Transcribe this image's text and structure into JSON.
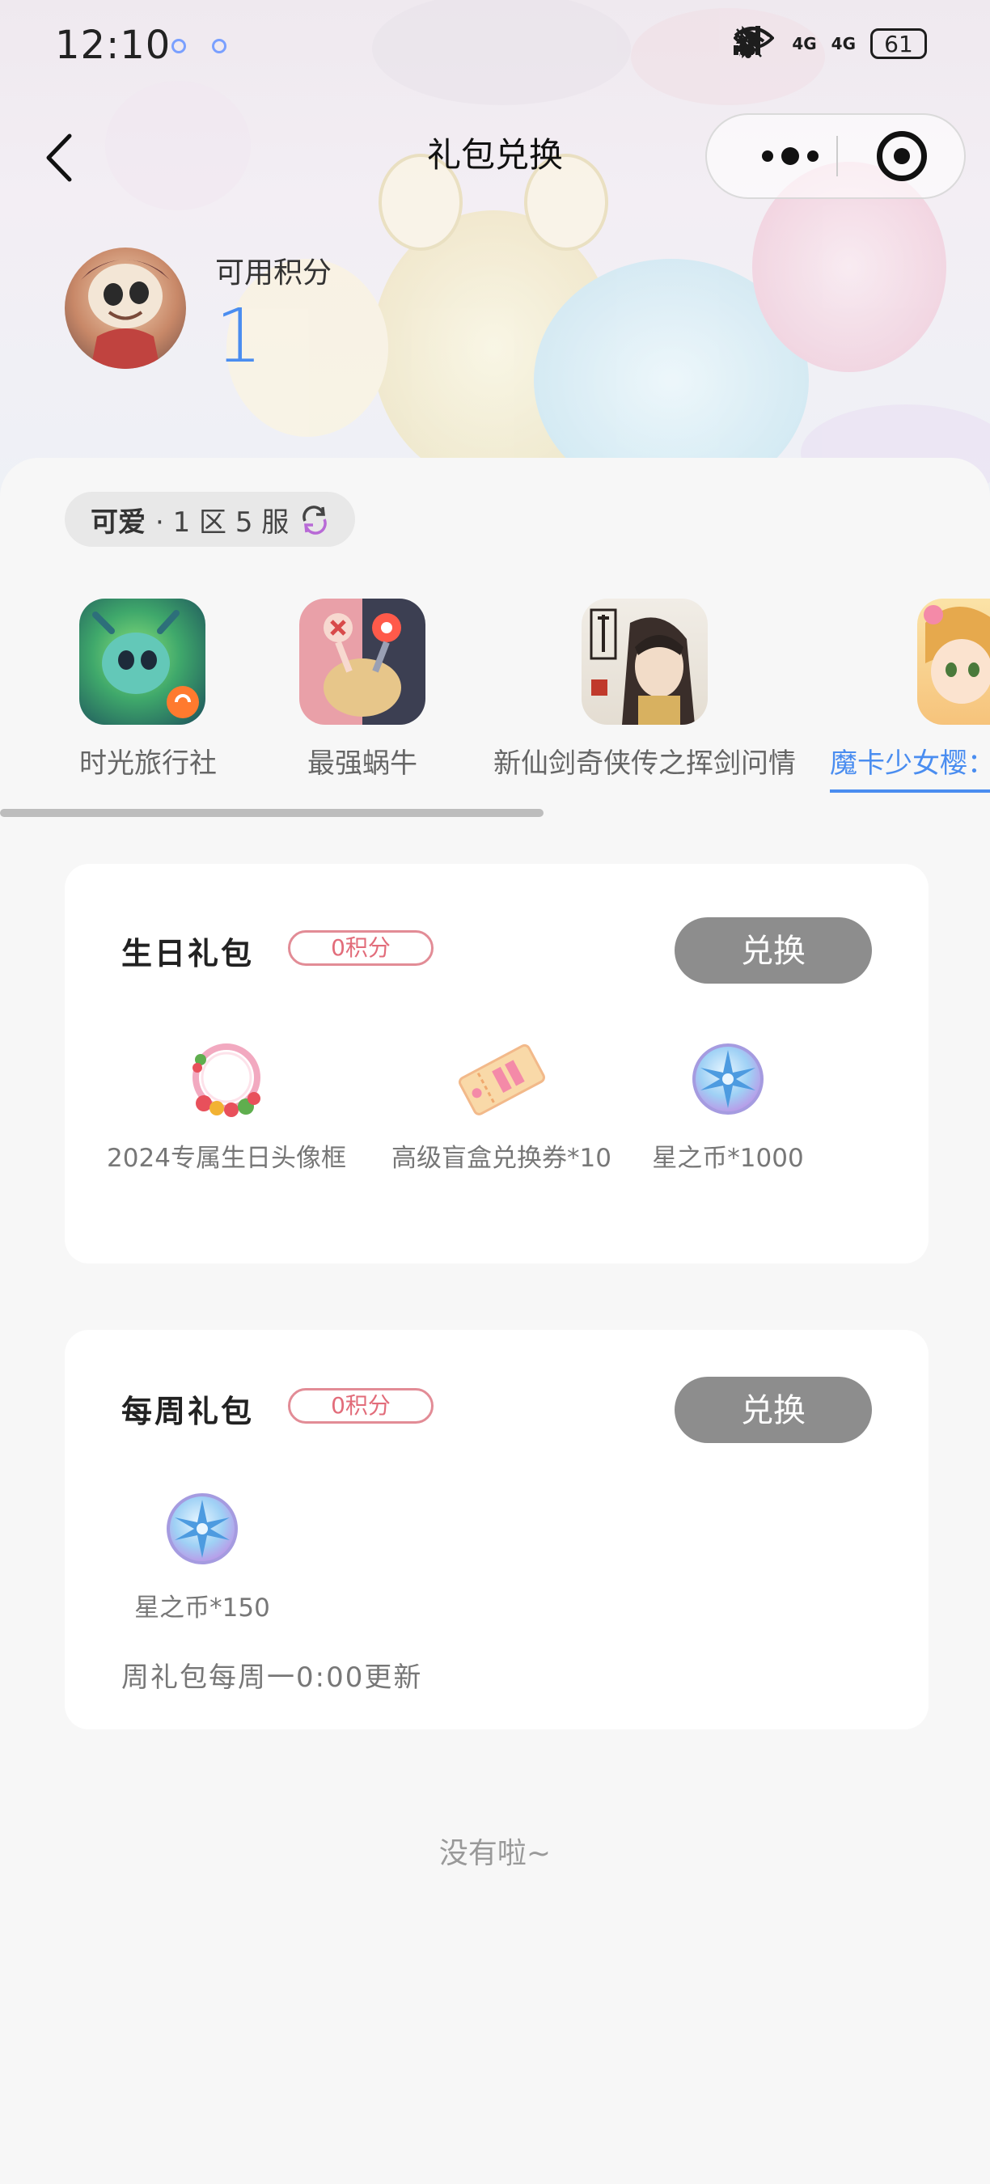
{
  "status_bar": {
    "time": "12:10",
    "battery": "61",
    "network_1": "4G",
    "network_2": "4G"
  },
  "nav": {
    "title": "礼包兑换"
  },
  "points": {
    "label": "可用积分",
    "value": "1"
  },
  "server": {
    "name": "可爱",
    "zone": "· 1 区 5 服"
  },
  "games": [
    {
      "name": "时光旅行社",
      "active": false
    },
    {
      "name": "最强蜗牛",
      "active": false
    },
    {
      "name": "新仙剑奇侠传之挥剑问情",
      "active": false
    },
    {
      "name": "魔卡少女樱：",
      "active": true
    }
  ],
  "gift_packs": [
    {
      "title": "生日礼包",
      "cost": "0积分",
      "button": "兑换",
      "items": [
        {
          "label": "2024专属生日头像框",
          "icon": "wreath-frame-icon"
        },
        {
          "label": "高级盲盒兑换券*10",
          "icon": "ticket-icon"
        },
        {
          "label": "星之币*1000",
          "icon": "star-coin-icon"
        }
      ]
    },
    {
      "title": "每周礼包",
      "cost": "0积分",
      "button": "兑换",
      "items": [
        {
          "label": "星之币*150",
          "icon": "star-coin-icon"
        }
      ],
      "note": "周礼包每周一0:00更新"
    }
  ],
  "footer": {
    "end_text": "没有啦~"
  },
  "colors": {
    "accent": "#4a8df0",
    "badge": "#e26c7a",
    "button": "#8d8d8d",
    "background": "#f7f7f7"
  }
}
